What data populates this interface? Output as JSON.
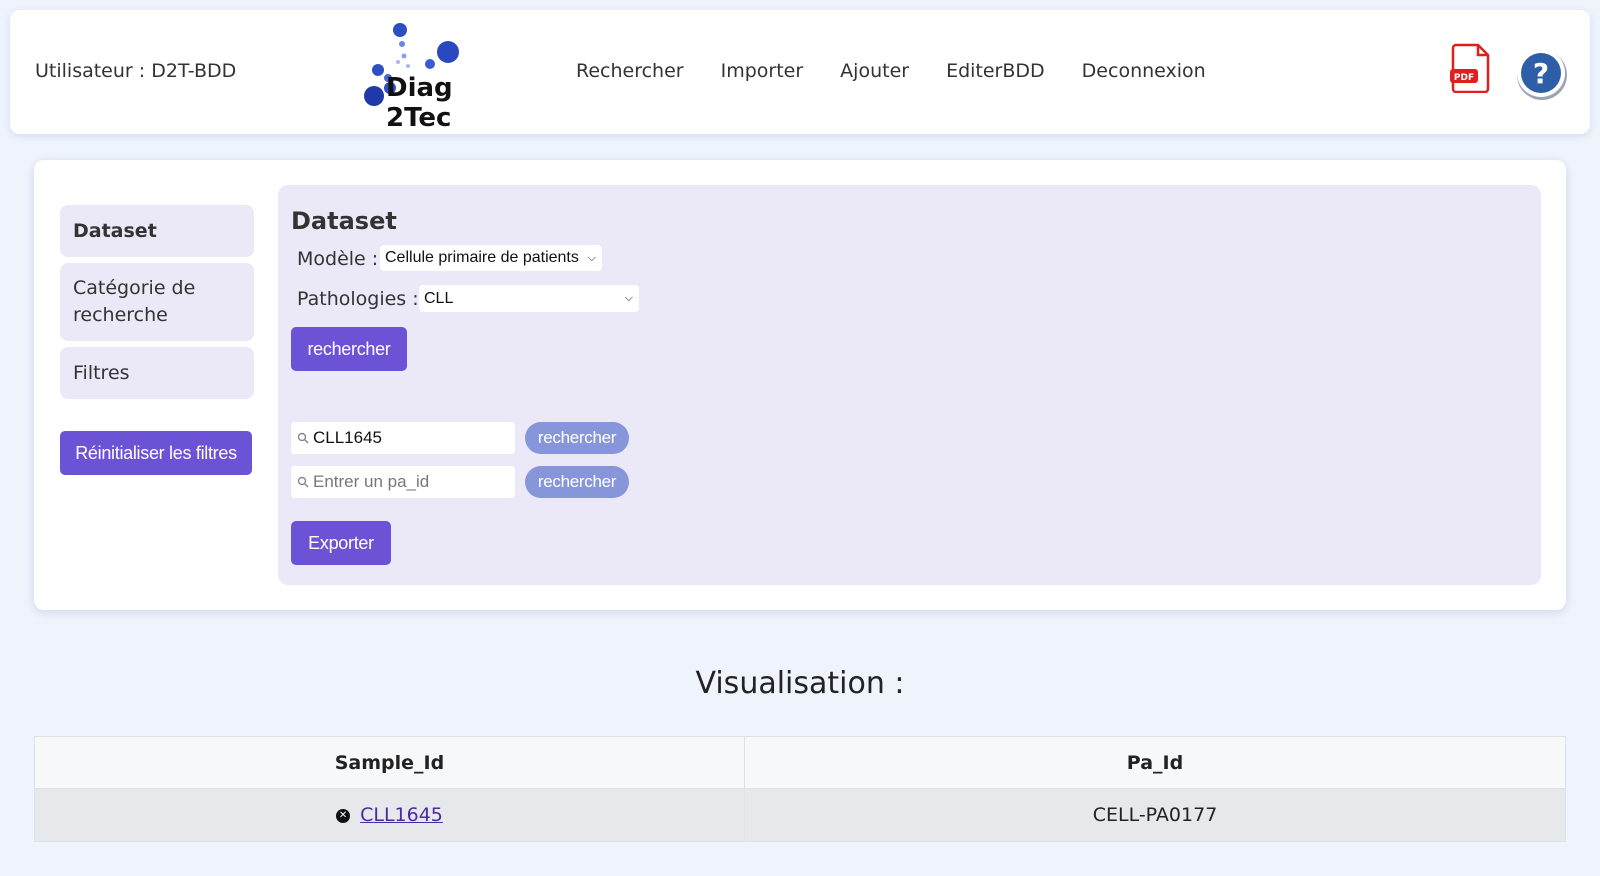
{
  "header": {
    "user_label": "Utilisateur : D2T-BDD",
    "logo_text": "Diag2Tec",
    "nav": [
      "Rechercher",
      "Importer",
      "Ajouter",
      "EditerBDD",
      "Deconnexion"
    ],
    "pdf_label": "PDF"
  },
  "sidebar": {
    "items": [
      {
        "label": "Dataset"
      },
      {
        "label": "Catégorie de recherche"
      },
      {
        "label": "Filtres"
      }
    ],
    "reset_label": "Réinitialiser les filtres"
  },
  "dataset": {
    "title": "Dataset",
    "model_label": "Modèle :",
    "model_value": "Cellule primaire de patients",
    "pathology_label": "Pathologies :",
    "pathology_value": "CLL",
    "search_button": "rechercher",
    "sample_search": {
      "value": "CLL1645",
      "button": "rechercher"
    },
    "pa_search": {
      "placeholder": "Entrer un pa_id",
      "button": "rechercher"
    },
    "export_button": "Exporter"
  },
  "visualisation": {
    "title": "Visualisation :",
    "columns": [
      "Sample_Id",
      "Pa_Id"
    ],
    "rows": [
      {
        "sample_id": "CLL1645",
        "pa_id": "CELL-PA0177"
      }
    ]
  },
  "colors": {
    "accent": "#6c53d6",
    "pill": "#8796db",
    "panel_bg": "#ebe8f8",
    "page_bg": "#eef3fc"
  }
}
